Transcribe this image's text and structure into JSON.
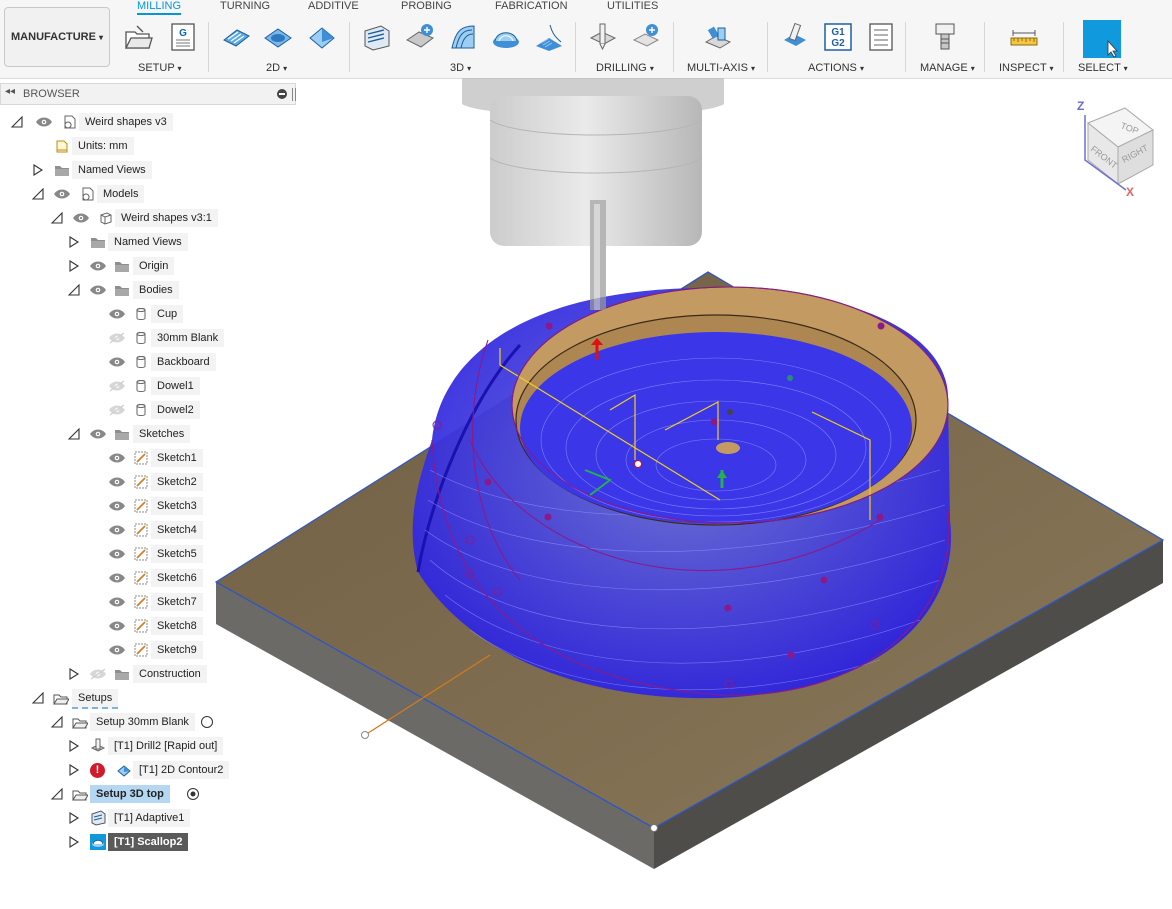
{
  "toolbar": {
    "workspace": "MANUFACTURE",
    "tabs": [
      {
        "label": "MILLING",
        "active": true
      },
      {
        "label": "TURNING",
        "active": false
      },
      {
        "label": "ADDITIVE",
        "active": false
      },
      {
        "label": "PROBING",
        "active": false
      },
      {
        "label": "FABRICATION",
        "active": false
      },
      {
        "label": "UTILITIES",
        "active": false
      }
    ],
    "groups": [
      "SETUP",
      "2D",
      "3D",
      "DRILLING",
      "MULTI-AXIS",
      "ACTIONS",
      "MANAGE",
      "INSPECT",
      "SELECT"
    ],
    "gcode_line1": "G1",
    "gcode_line2": "G2",
    "setup_doc_letter": "G"
  },
  "browser": {
    "title": "BROWSER",
    "tree": [
      {
        "label": "Weird shapes v3",
        "exp": "open",
        "eye": "on",
        "icon": "doc"
      },
      {
        "label": "Units: mm",
        "icon": "units"
      },
      {
        "label": "Named Views",
        "exp": "closed",
        "icon": "folder"
      },
      {
        "label": "Models",
        "exp": "open",
        "eye": "on",
        "icon": "doc"
      },
      {
        "label": "Weird shapes v3:1",
        "exp": "open",
        "eye": "on",
        "icon": "component"
      },
      {
        "label": "Named Views",
        "exp": "closed",
        "icon": "folder"
      },
      {
        "label": "Origin",
        "exp": "closed",
        "eye": "on",
        "icon": "folder"
      },
      {
        "label": "Bodies",
        "exp": "open",
        "eye": "on",
        "icon": "folder"
      },
      {
        "label": "Cup",
        "eye": "on",
        "icon": "body"
      },
      {
        "label": "30mm Blank",
        "eye": "off",
        "icon": "body"
      },
      {
        "label": "Backboard",
        "eye": "on",
        "icon": "body"
      },
      {
        "label": "Dowel1",
        "eye": "off",
        "icon": "body"
      },
      {
        "label": "Dowel2",
        "eye": "off",
        "icon": "body"
      },
      {
        "label": "Sketches",
        "exp": "open",
        "eye": "on",
        "icon": "folder"
      },
      {
        "label": "Sketch1",
        "eye": "on",
        "icon": "sketch"
      },
      {
        "label": "Sketch2",
        "eye": "on",
        "icon": "sketch"
      },
      {
        "label": "Sketch3",
        "eye": "on",
        "icon": "sketch"
      },
      {
        "label": "Sketch4",
        "eye": "on",
        "icon": "sketch"
      },
      {
        "label": "Sketch5",
        "eye": "on",
        "icon": "sketch"
      },
      {
        "label": "Sketch6",
        "eye": "on",
        "icon": "sketch"
      },
      {
        "label": "Sketch7",
        "eye": "on",
        "icon": "sketch"
      },
      {
        "label": "Sketch8",
        "eye": "on",
        "icon": "sketch"
      },
      {
        "label": "Sketch9",
        "eye": "on",
        "icon": "sketch"
      },
      {
        "label": "Construction",
        "exp": "closed",
        "eye": "off",
        "icon": "folder"
      },
      {
        "label": "Setups",
        "exp": "open",
        "icon": "setup-folder",
        "style": "dashed"
      },
      {
        "label": "Setup 30mm Blank",
        "exp": "open",
        "icon": "setup-folder",
        "marker": "circle"
      },
      {
        "label": "[T1] Drill2 [Rapid out]",
        "exp": "closed",
        "icon": "drill"
      },
      {
        "label": "[T1] 2D Contour2",
        "exp": "closed",
        "icon": "contour",
        "warning": "!"
      },
      {
        "label": "Setup 3D top",
        "exp": "open",
        "icon": "setup-folder",
        "marker": "dot",
        "style": "selected"
      },
      {
        "label": "[T1] Adaptive1",
        "exp": "closed",
        "icon": "adaptive"
      },
      {
        "label": "[T1] Scallop2",
        "exp": "closed",
        "icon": "scallop",
        "style": "active"
      }
    ]
  },
  "viewcube": {
    "top": "TOP",
    "front": "FRONT",
    "right": "RIGHT",
    "axis_z": "Z",
    "axis_x": "X"
  },
  "colors": {
    "accent": "#0696d7",
    "toolpath": "#2b1fe0",
    "stock_top": "#7d6a4d",
    "stock_side": "#5d5c58",
    "cup_rim": "#c29a62",
    "sketch": "#8b1a88",
    "warning": "#d11a2a"
  }
}
